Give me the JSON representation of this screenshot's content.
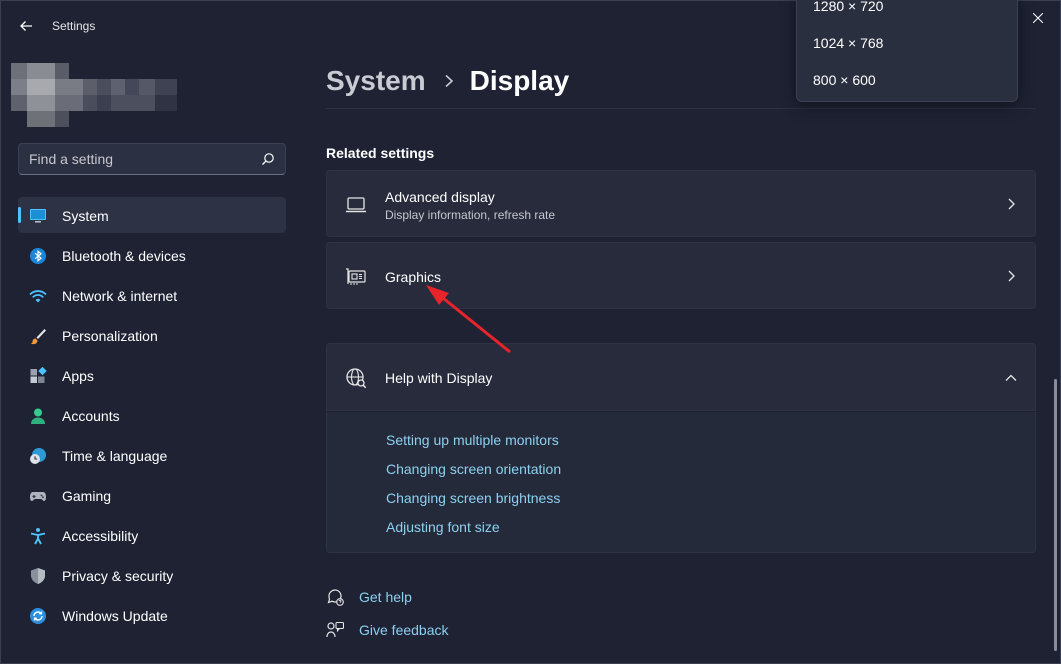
{
  "window": {
    "title": "Settings"
  },
  "search": {
    "placeholder": "Find a setting"
  },
  "sidebar": {
    "items": [
      {
        "label": "System",
        "icon": "monitor-icon"
      },
      {
        "label": "Bluetooth & devices",
        "icon": "bluetooth-icon"
      },
      {
        "label": "Network & internet",
        "icon": "wifi-icon"
      },
      {
        "label": "Personalization",
        "icon": "brush-icon"
      },
      {
        "label": "Apps",
        "icon": "apps-icon"
      },
      {
        "label": "Accounts",
        "icon": "person-icon"
      },
      {
        "label": "Time & language",
        "icon": "globe-clock-icon"
      },
      {
        "label": "Gaming",
        "icon": "gamepad-icon"
      },
      {
        "label": "Accessibility",
        "icon": "accessibility-icon"
      },
      {
        "label": "Privacy & security",
        "icon": "shield-icon"
      },
      {
        "label": "Windows Update",
        "icon": "update-icon"
      }
    ]
  },
  "breadcrumb": {
    "parent": "System",
    "current": "Display"
  },
  "related": {
    "title": "Related settings",
    "advanced": {
      "title": "Advanced display",
      "subtitle": "Display information, refresh rate"
    },
    "graphics": {
      "title": "Graphics"
    }
  },
  "help": {
    "title": "Help with Display",
    "links": [
      "Setting up multiple monitors",
      "Changing screen orientation",
      "Changing screen brightness",
      "Adjusting font size"
    ]
  },
  "footer": {
    "get_help": "Get help",
    "give_feedback": "Give feedback"
  },
  "dropdown": {
    "options": [
      "1280 × 720",
      "1024 × 768",
      "800 × 600"
    ]
  },
  "colors": {
    "accent": "#4cc2ff",
    "link": "#8cd1f0",
    "annotation": "#e8242b"
  }
}
